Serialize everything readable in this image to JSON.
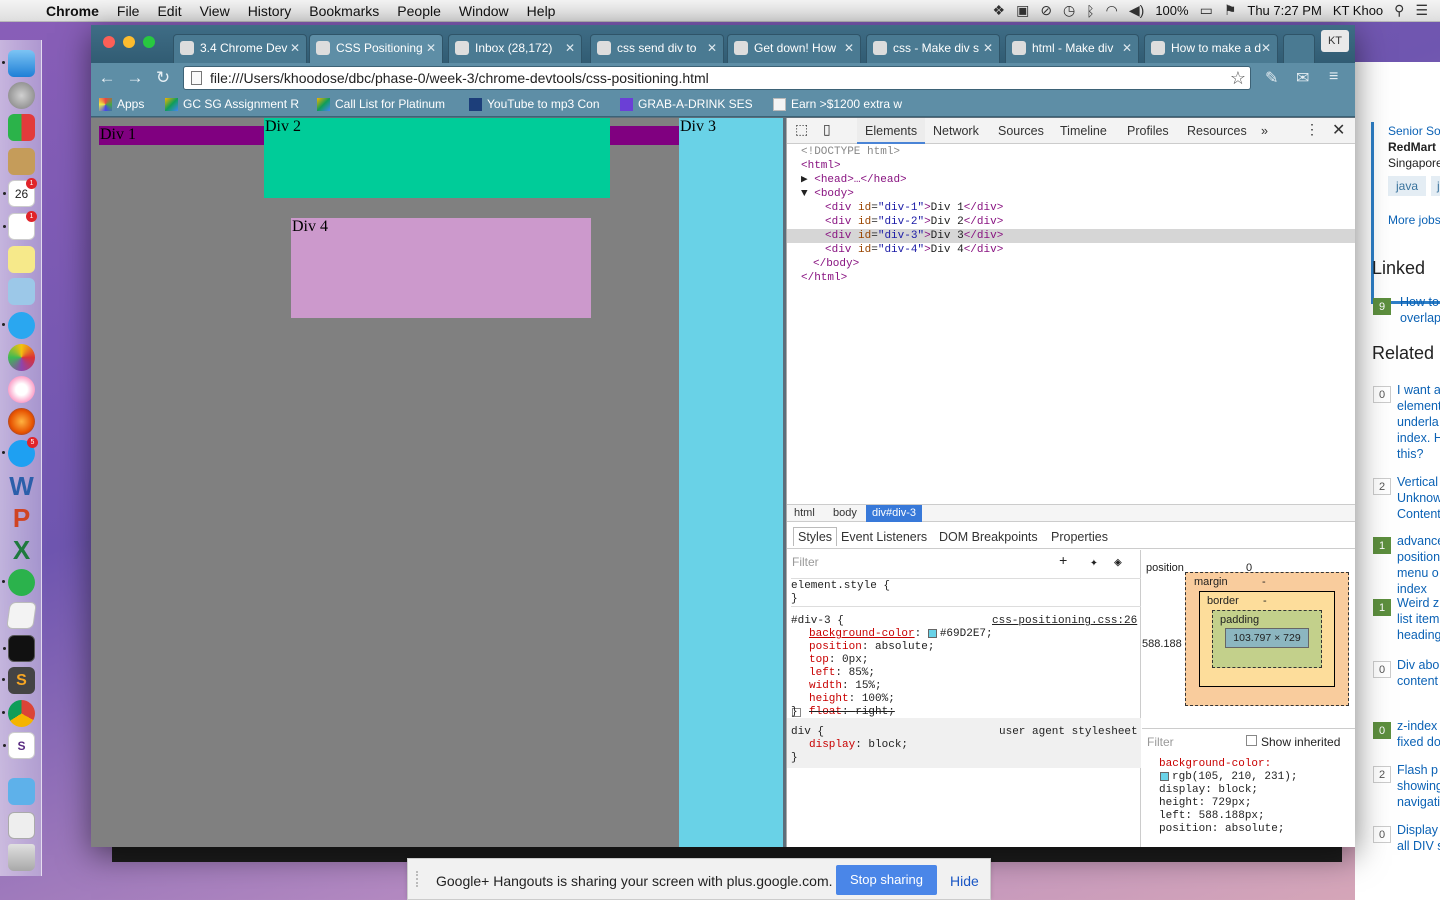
{
  "menubar": {
    "app": "Chrome",
    "items": [
      "File",
      "Edit",
      "View",
      "History",
      "Bookmarks",
      "People",
      "Window",
      "Help"
    ],
    "battery": "100%",
    "clock": "Thu 7:27 PM",
    "user": "KT Khoo"
  },
  "dock": {
    "badges": {
      "calendar_date": "26",
      "calendar": "1",
      "reminders": "1",
      "appstore": "5"
    }
  },
  "browser": {
    "tabs": [
      {
        "label": "3.4 Chrome Dev",
        "active": false
      },
      {
        "label": "CSS Positioning",
        "active": true
      },
      {
        "label": "Inbox (28,172)",
        "active": false
      },
      {
        "label": "css send div to",
        "active": false
      },
      {
        "label": "Get down! How",
        "active": false
      },
      {
        "label": "css - Make div s",
        "active": false
      },
      {
        "label": "html - Make div",
        "active": false
      },
      {
        "label": "How to make a d",
        "active": false
      }
    ],
    "profile": "KT",
    "url": "file:///Users/khoodose/dbc/phase-0/week-3/chrome-devtools/css-positioning.html",
    "bookmarks": [
      "Apps",
      "GC SG Assignment R",
      "Call List for Platinum",
      "YouTube to mp3 Con",
      "GRAB-A-DRINK SESS",
      "Earn >$1200 extra w"
    ]
  },
  "page": {
    "div1": "Div 1",
    "div2": "Div 2",
    "div3": "Div 3",
    "div4": "Div 4",
    "colors": {
      "bg": "#808080",
      "div1": "#800080",
      "div2": "#00cc99",
      "div3": "#69D2E7",
      "div4": "#cc99cc"
    }
  },
  "devtools": {
    "tabs": [
      "Elements",
      "Network",
      "Sources",
      "Timeline",
      "Profiles",
      "Resources",
      "»"
    ],
    "dom": {
      "doctype": "<!DOCTYPE html>",
      "html_open": "<html>",
      "head": "<head>…</head>",
      "body_open": "<body>",
      "children": [
        {
          "id": "div-1",
          "text": "Div 1"
        },
        {
          "id": "div-2",
          "text": "Div 2"
        },
        {
          "id": "div-3",
          "text": "Div 3"
        },
        {
          "id": "div-4",
          "text": "Div 4"
        }
      ],
      "body_close": "</body>",
      "html_close": "</html>"
    },
    "breadcrumbs": [
      "html",
      "body",
      "div#div-3"
    ],
    "subtabs": [
      "Styles",
      "Event Listeners",
      "DOM Breakpoints",
      "Properties"
    ],
    "filter_placeholder": "Filter",
    "styles": {
      "element_style": "element.style {",
      "rule_selector": "#div-3 {",
      "rule_source": "css-positioning.css:26",
      "props": [
        {
          "name": "background-color",
          "value": "#69D2E7;"
        },
        {
          "name": "position",
          "value": "absolute;"
        },
        {
          "name": "top",
          "value": "0px;"
        },
        {
          "name": "left",
          "value": "85%;"
        },
        {
          "name": "width",
          "value": "15%;"
        },
        {
          "name": "height",
          "value": "100%;"
        },
        {
          "name": "float",
          "value": "right;"
        }
      ],
      "ua_selector": "div {",
      "ua_label": "user agent stylesheet",
      "ua_prop": "display",
      "ua_value": "block;"
    },
    "boxmodel": {
      "position_label": "position",
      "position_top": "0",
      "position_left": "588.188",
      "margin_label": "margin",
      "border_label": "border",
      "padding_label": "padding",
      "dash": "-",
      "content": "103.797 × 729"
    },
    "computed": {
      "filter": "Filter",
      "show_inherited": "Show inherited",
      "lines": [
        "background-color:",
        "rgb(105, 210, 231);",
        "display: block;",
        "height: 729px;",
        "left: 588.188px;",
        "position: absolute;"
      ]
    }
  },
  "background_page": {
    "job_title": "Senior So",
    "company": "RedMart",
    "location": "Singapore",
    "tags": [
      "java",
      "ja"
    ],
    "more_jobs": "More jobs",
    "linked_heading": "Linked",
    "linked": [
      {
        "votes": "9",
        "text": [
          "How to",
          "overlap"
        ]
      }
    ],
    "related_heading": "Related",
    "related": [
      {
        "votes": "0",
        "text": [
          "I want a",
          "element",
          "underla",
          "index. H",
          "this?"
        ]
      },
      {
        "votes": "2",
        "text": [
          "Vertical",
          "Unknow",
          "Content"
        ]
      },
      {
        "votes": "1",
        "text": [
          "advance",
          "position",
          "menu o",
          "index"
        ]
      },
      {
        "votes": "1",
        "text": [
          "Weird z",
          "list item",
          "heading"
        ]
      },
      {
        "votes": "0",
        "text": [
          "Div abo",
          "content"
        ]
      },
      {
        "votes": "0",
        "text": [
          "z-index",
          "fixed do"
        ]
      },
      {
        "votes": "2",
        "text": [
          "Flash p",
          "showing",
          "navigati"
        ]
      },
      {
        "votes": "0",
        "text": [
          "Display",
          "all DIV s"
        ]
      }
    ]
  },
  "notification": {
    "message": "Google+ Hangouts is sharing your screen with plus.google.com.",
    "stop": "Stop sharing",
    "hide": "Hide"
  }
}
